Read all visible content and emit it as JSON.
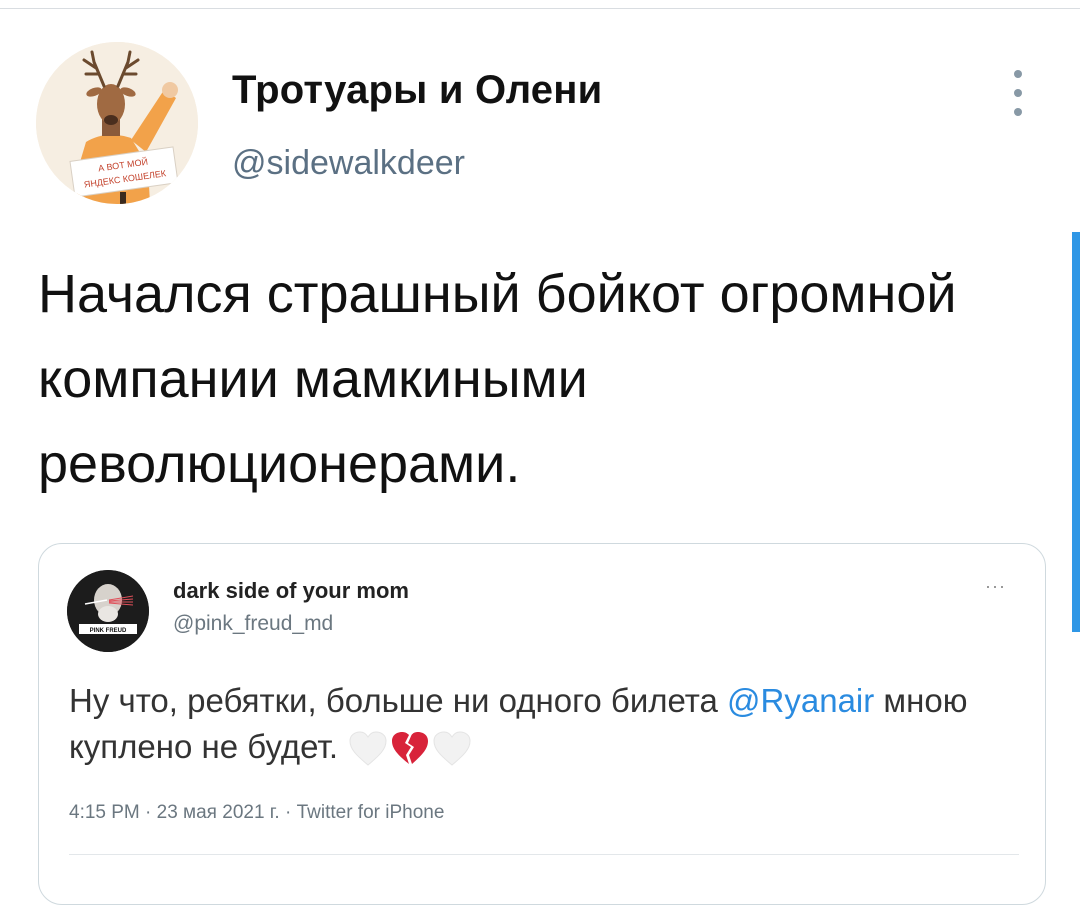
{
  "author": {
    "name": "Тротуары и Олени",
    "handle": "@sidewalkdeer",
    "avatar_sign_line1": "А ВОТ МОЙ",
    "avatar_sign_line2": "ЯНДЕКС КОШЕЛЕК"
  },
  "tweet": {
    "text": "Начался страшный бойкот огромной компании мамкиными революционерами."
  },
  "quoted": {
    "name": "dark side of your mom",
    "handle": "@pink_freud_md",
    "avatar_label": "PINK FREUD",
    "more_label": "···",
    "text_before": "Ну что, ребятки, больше ни одного билета ",
    "mention": "@Ryanair",
    "text_after": " мною куплено не будет.",
    "emojis": [
      "white-heart",
      "broken-heart",
      "white-heart"
    ],
    "meta": "4:15 PM · 23 мая 2021 г. · Twitter for iPhone"
  },
  "colors": {
    "accent": "#2f97e6",
    "mention": "#2a8be0",
    "broken_heart": "#d8233a",
    "white_heart": "#f2f2f2"
  }
}
